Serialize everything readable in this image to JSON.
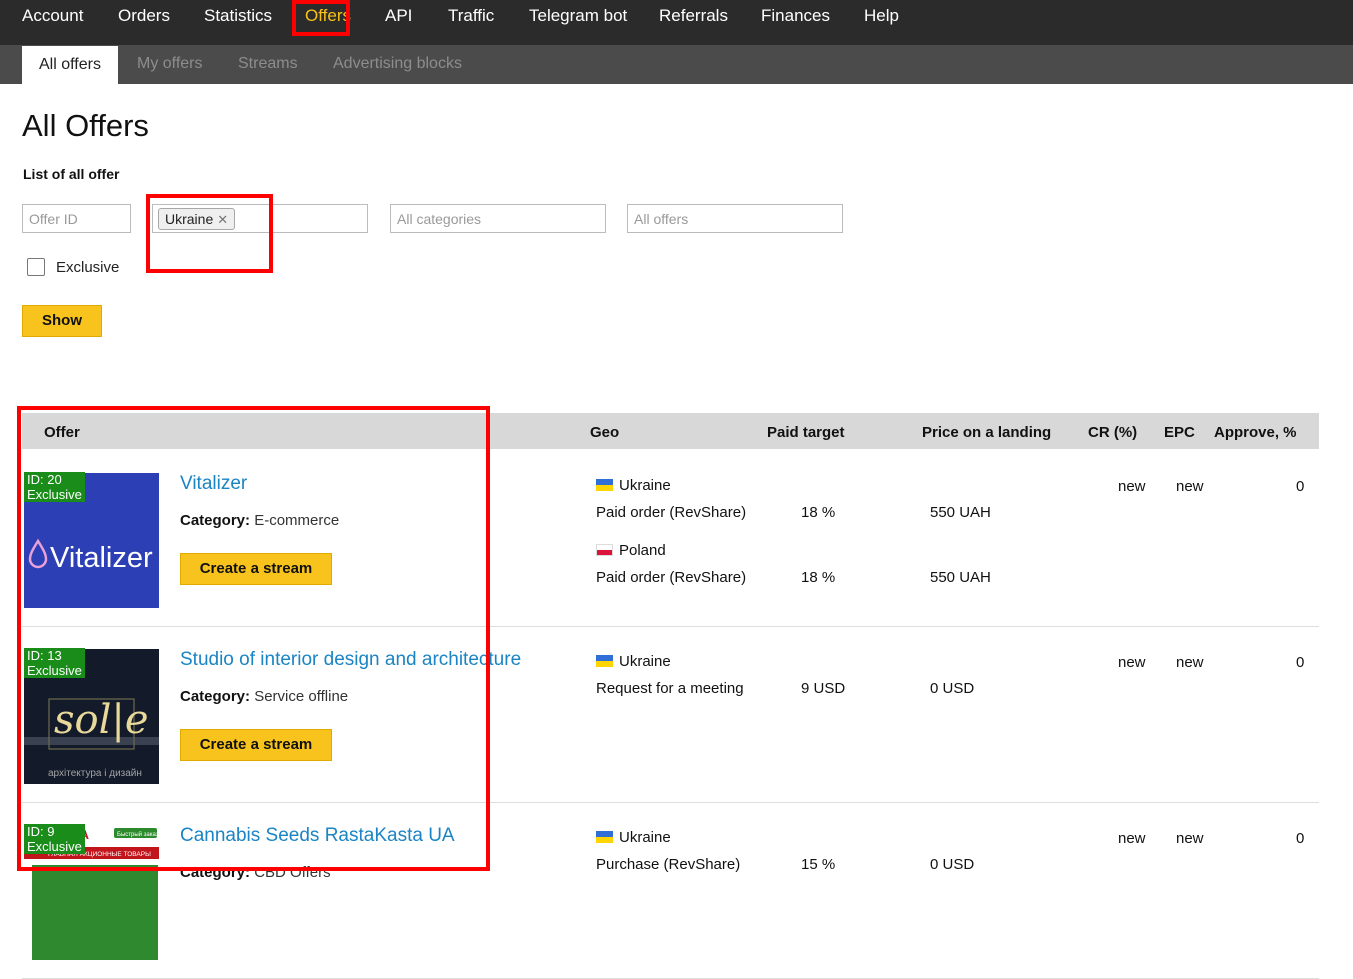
{
  "nav": {
    "items": [
      "Account",
      "Orders",
      "Statistics",
      "Offers",
      "API",
      "Traffic",
      "Telegram bot",
      "Referrals",
      "Finances",
      "Help"
    ],
    "active": "Offers"
  },
  "subnav": {
    "tabs": [
      "All offers",
      "My offers",
      "Streams",
      "Advertising blocks"
    ],
    "active": "All offers"
  },
  "page": {
    "title": "All Offers",
    "subtitle": "List of all offer"
  },
  "filters": {
    "offer_id_placeholder": "Offer ID",
    "geo_chip": "Ukraine",
    "category_placeholder": "All categories",
    "offers_placeholder": "All offers",
    "exclusive_label": "Exclusive",
    "exclusive_checked": false,
    "show_label": "Show"
  },
  "table": {
    "headers": [
      "Offer",
      "Geo",
      "Paid target",
      "Price on a landing",
      "CR (%)",
      "EPC",
      "Approve, %"
    ],
    "category_label": "Category:",
    "create_stream_label": "Create a stream",
    "rows": [
      {
        "id_badge": "ID: 20\nExclusive",
        "title": "Vitalizer",
        "category": "E-commerce",
        "logo_text": "Vitalizer",
        "cr": "new",
        "epc": "new",
        "approve": "0",
        "geos": [
          {
            "country": "Ukraine",
            "flag": "ua",
            "target": "Paid order (RevShare)",
            "paid": "18 %",
            "price": "550 UAH"
          },
          {
            "country": "Poland",
            "flag": "pl",
            "target": "Paid order (RevShare)",
            "paid": "18 %",
            "price": "550 UAH"
          }
        ]
      },
      {
        "id_badge": "ID: 13\nExclusive",
        "title": "Studio of interior design and architecture",
        "category": "Service offline",
        "logo_text": "sol|e",
        "logo_subtext": "архітектура і дизайн",
        "cr": "new",
        "epc": "new",
        "approve": "0",
        "geos": [
          {
            "country": "Ukraine",
            "flag": "ua",
            "target": "Request for a meeting",
            "paid": "9 USD",
            "price": "0 USD"
          }
        ]
      },
      {
        "id_badge": "ID: 9\nExclusive",
        "title": "Cannabis Seeds RastaKasta UA",
        "category": "CBD Offers",
        "logo_text": "STA",
        "logo_subtext": "ГЛАВНАЯ   АКЦИОННЫЕ ТОВАРЫ",
        "logo_badge": "Быстрый заказ",
        "cr": "new",
        "epc": "new",
        "approve": "0",
        "geos": [
          {
            "country": "Ukraine",
            "flag": "ua",
            "target": "Purchase (RevShare)",
            "paid": "15 %",
            "price": "0 USD"
          }
        ]
      }
    ]
  }
}
